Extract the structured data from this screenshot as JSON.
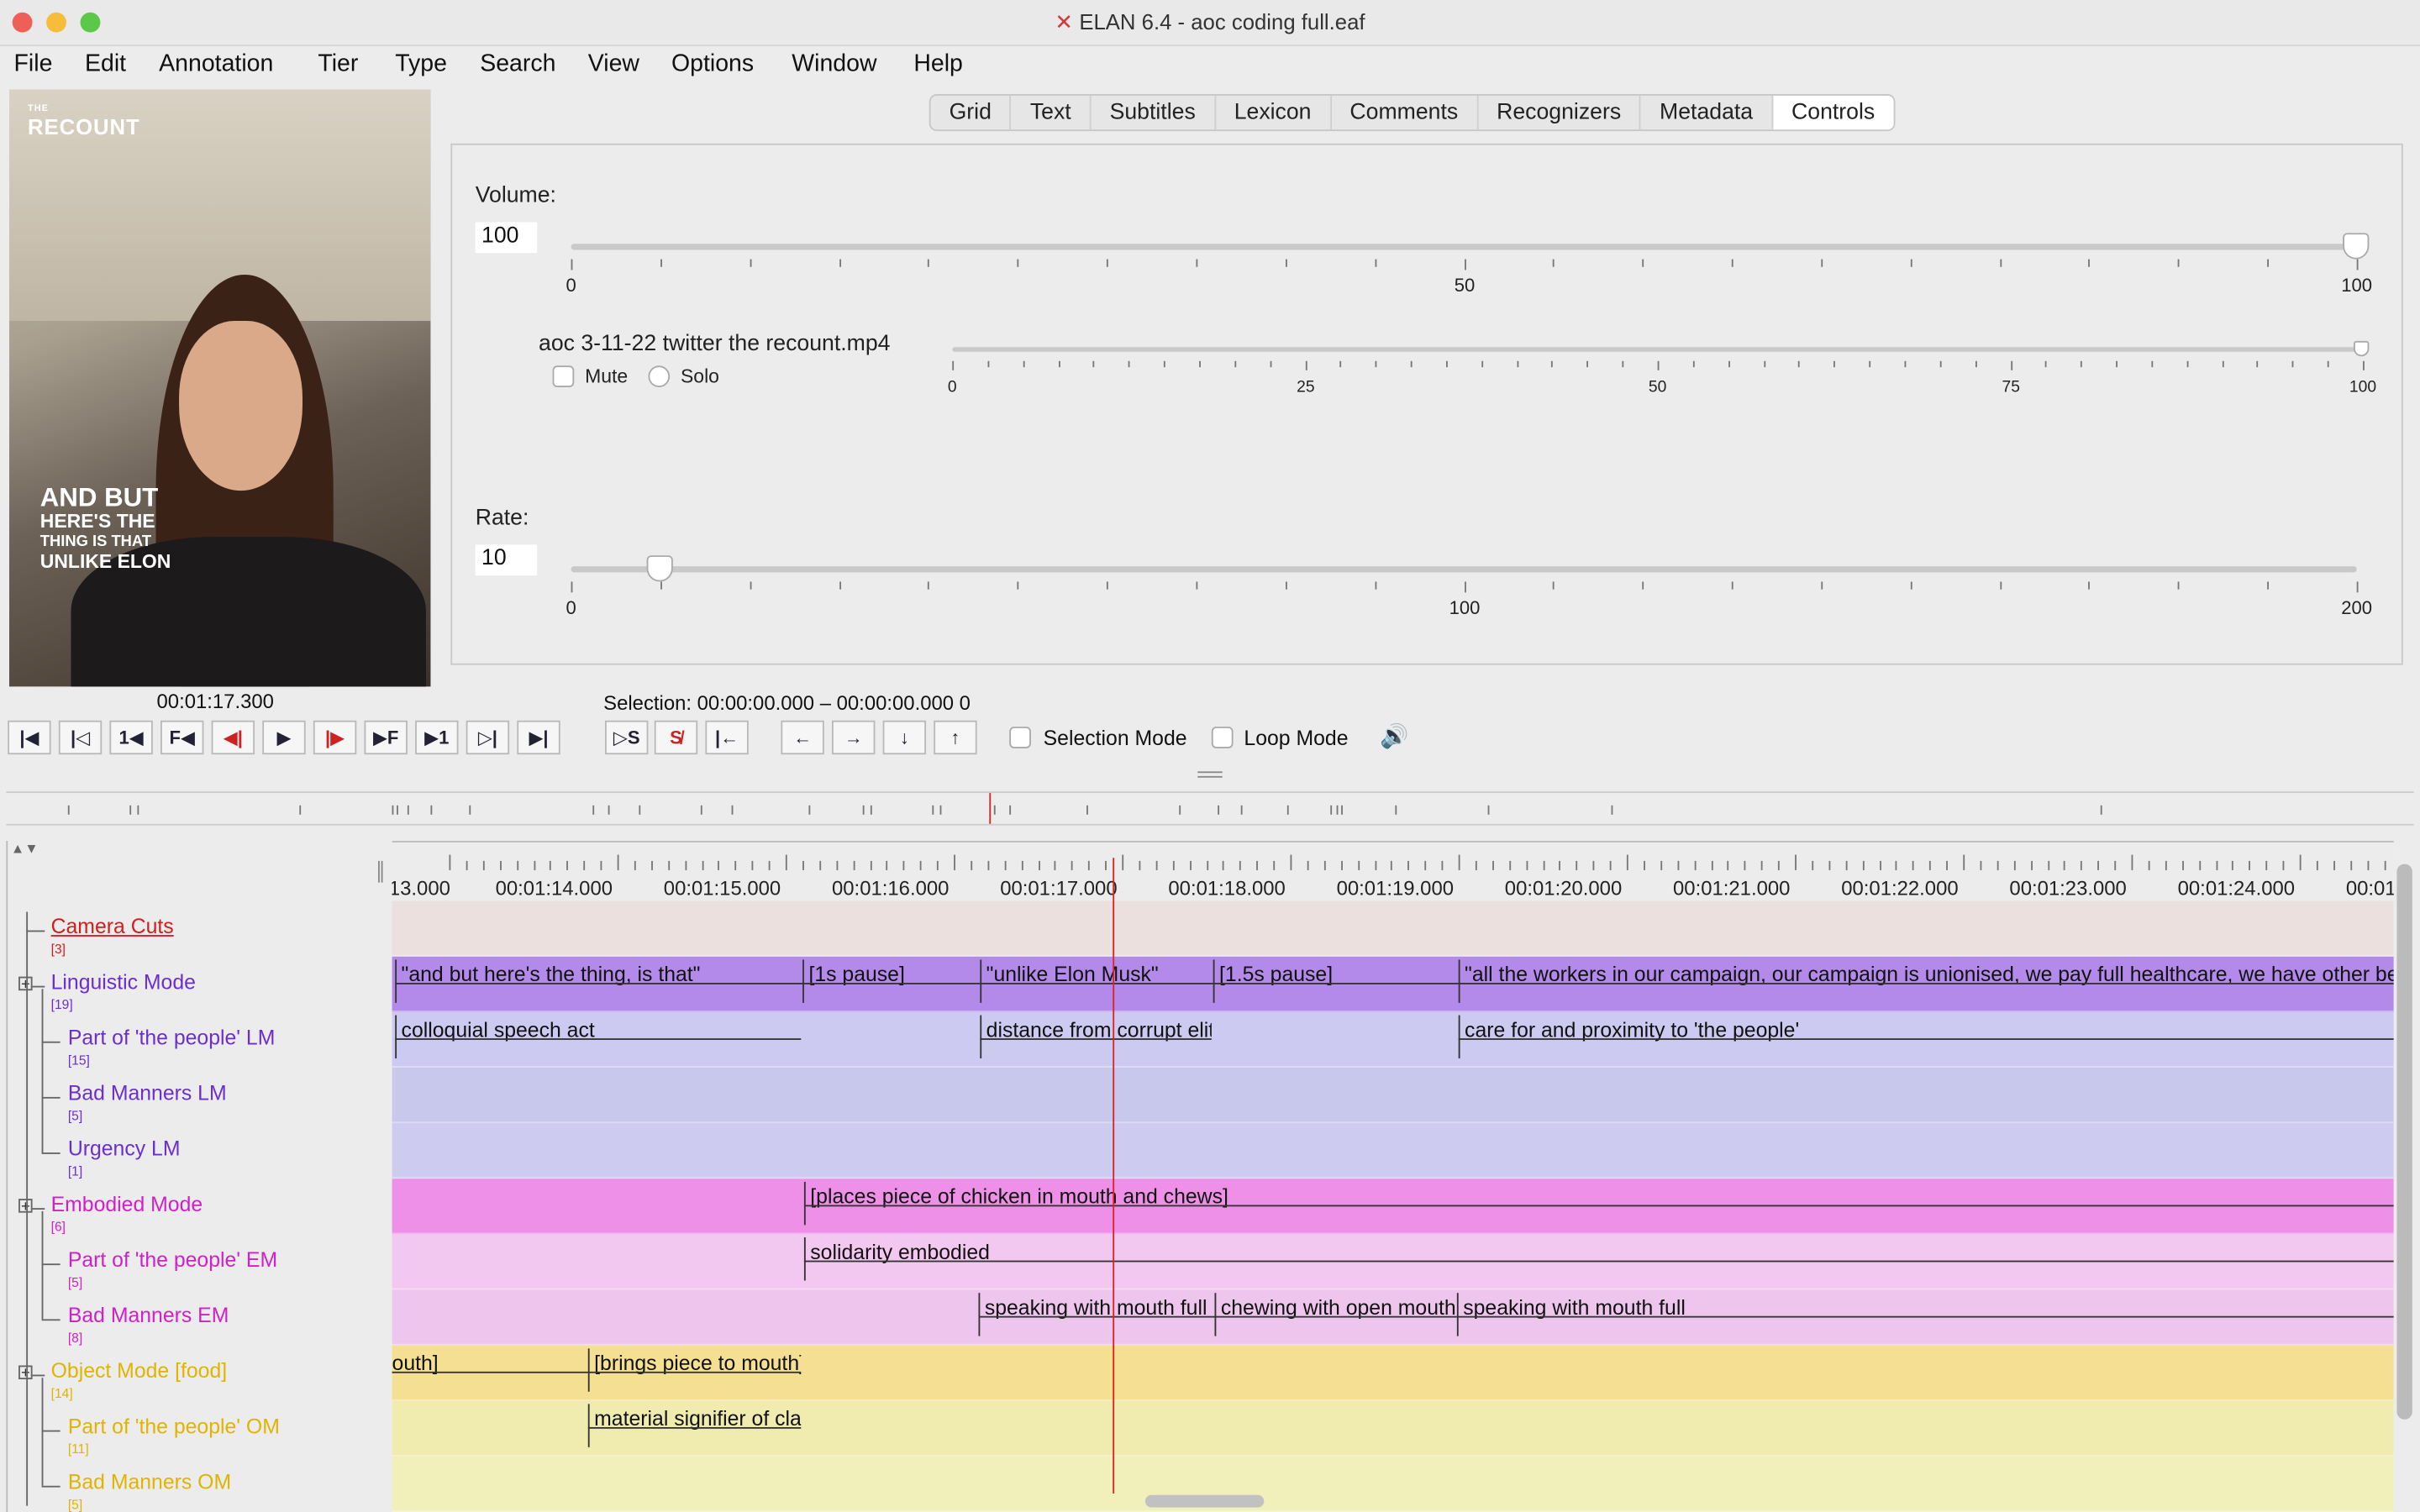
{
  "window": {
    "title": "ELAN 6.4 - aoc coding full.eaf",
    "traffic_lights": {
      "close": "#ee5f58",
      "minimize": "#f6bd3b",
      "zoom": "#5bc84a"
    }
  },
  "menu": [
    "File",
    "Edit",
    "Annotation",
    "Tier",
    "Type",
    "Search",
    "View",
    "Options",
    "Window",
    "Help"
  ],
  "video": {
    "brand_small": "THE",
    "brand": "RECOUNT",
    "caption_big": "AND BUT",
    "caption_lines": [
      "HERE'S THE",
      "THING IS THAT",
      "UNLIKE ELON"
    ],
    "timecode": "00:01:17.300"
  },
  "tabs": [
    "Grid",
    "Text",
    "Subtitles",
    "Lexicon",
    "Comments",
    "Recognizers",
    "Metadata",
    "Controls"
  ],
  "active_tab": "Controls",
  "controls": {
    "volume_label": "Volume:",
    "volume_value": "100",
    "volume_ticks": [
      "0",
      "50",
      "100"
    ],
    "media_file": "aoc 3-11-22 twitter the recount.mp4",
    "media_ticks": [
      "0",
      "25",
      "50",
      "75",
      "100"
    ],
    "mute_label": "Mute",
    "solo_label": "Solo",
    "media_volume": 100,
    "rate_label": "Rate:",
    "rate_value": "10",
    "rate_ticks": [
      "0",
      "100",
      "200"
    ]
  },
  "transport": {
    "selection_text": "Selection: 00:00:00.000 – 00:00:00.000  0",
    "buttons": [
      "⏮",
      "⏮",
      "1◂",
      "F◂",
      "◂|",
      "▶",
      "|▸",
      "▸F",
      "▸1",
      "⏭",
      "⏭"
    ],
    "sel_buttons": [
      "▷S",
      "S",
      "|←",
      "←",
      "→",
      "↓",
      "↑"
    ],
    "selection_mode_label": "Selection Mode",
    "loop_mode_label": "Loop Mode",
    "speaker_icon": "🔊"
  },
  "ruler": [
    "13.000",
    "00:01:14.000",
    "00:01:15.000",
    "00:01:16.000",
    "00:01:17.000",
    "00:01:18.000",
    "00:01:19.000",
    "00:01:20.000",
    "00:01:21.000",
    "00:01:22.000",
    "00:01:23.000",
    "00:01:24.000",
    "00:01:2"
  ],
  "tiers": [
    {
      "name": "Camera Cuts",
      "count": "[3]",
      "color": "#d21d1d",
      "bg": "#ece0df",
      "indent": 0,
      "expand": false,
      "underline": true
    },
    {
      "name": "Linguistic Mode",
      "count": "[19]",
      "color": "#6b2fcf",
      "bg": "#b38ae9",
      "indent": 0,
      "expand": true
    },
    {
      "name": "Part of 'the people' LM",
      "count": "[15]",
      "color": "#6b2fcf",
      "bg": "#cccaf0",
      "indent": 1,
      "expand": false
    },
    {
      "name": "Bad Manners LM",
      "count": "[5]",
      "color": "#6b2fcf",
      "bg": "#c8c7ec",
      "indent": 1,
      "expand": false
    },
    {
      "name": "Urgency LM",
      "count": "[1]",
      "color": "#6b2fcf",
      "bg": "#cdcbf0",
      "indent": 1,
      "expand": false
    },
    {
      "name": "Embodied Mode",
      "count": "[6]",
      "color": "#d020c6",
      "bg": "#ee8fe8",
      "indent": 0,
      "expand": true
    },
    {
      "name": "Part of 'the people' EM",
      "count": "[5]",
      "color": "#d020c6",
      "bg": "#f3c8f0",
      "indent": 1,
      "expand": false
    },
    {
      "name": "Bad Manners EM",
      "count": "[8]",
      "color": "#d020c6",
      "bg": "#eec6ed",
      "indent": 1,
      "expand": false
    },
    {
      "name": "Object Mode [food]",
      "count": "[14]",
      "color": "#e0b400",
      "bg": "#f4df92",
      "indent": 0,
      "expand": true
    },
    {
      "name": "Part of 'the people' OM",
      "count": "[11]",
      "color": "#e0b400",
      "bg": "#f0ecb0",
      "indent": 1,
      "expand": false
    },
    {
      "name": "Bad Manners OM",
      "count": "[5]",
      "color": "#e0b400",
      "bg": "#f1efba",
      "indent": 1,
      "expand": false
    }
  ],
  "annotations": [
    [],
    [
      {
        "t": "\"and but here's the thing, is that\""
      },
      {
        "t": "[1s pause]"
      },
      {
        "t": "\"unlike Elon Musk\""
      },
      {
        "t": "[1.5s pause]"
      },
      {
        "t": "\"all the workers in our campaign, our campaign is unionised, we pay full healthcare, we have other ber"
      }
    ],
    [
      {
        "t": "colloquial speech act"
      },
      {
        "t": "distance from corrupt elit"
      },
      {
        "t": "care for and proximity to 'the people'"
      }
    ],
    [],
    [],
    [
      {
        "t": "[places piece of chicken in mouth and chews]"
      }
    ],
    [
      {
        "t": "solidarity embodied"
      }
    ],
    [
      {
        "t": "speaking with mouth full"
      },
      {
        "t": "chewing with open mouth"
      },
      {
        "t": "speaking with mouth full"
      }
    ],
    [
      {
        "t": "outh]"
      },
      {
        "t": "[brings piece to mouth]"
      }
    ],
    [
      {
        "t": "material signifier of cla"
      }
    ],
    []
  ]
}
